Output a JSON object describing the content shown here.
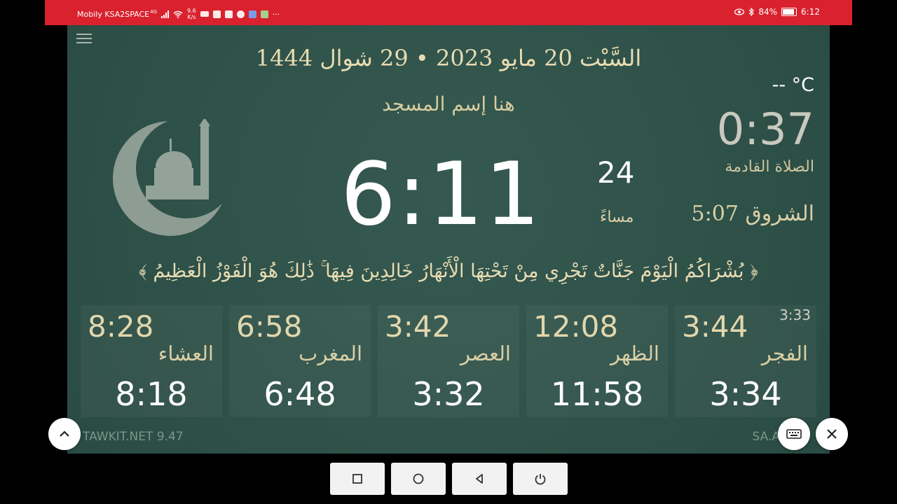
{
  "status_bar": {
    "carrier": "Mobily KSA2SPACE",
    "network": "4G",
    "net_speed_value": "9.6",
    "net_speed_unit": "K/s",
    "overflow": "···",
    "battery": "84%",
    "time": "6:12"
  },
  "app": {
    "date_line": "السَّبْت  20 مايو 2023  •  29 شوال 1444",
    "temperature": "-- °C",
    "mosque_name": "هنا إسم المسجد",
    "countdown": "0:37",
    "next_prayer_label": "الصلاة القادمة",
    "sunrise": "الشروق 5:07",
    "clock_time": "6:11",
    "clock_seconds": "24",
    "ampm": "مساءً",
    "verse": "﴿ بُشْرَاكُمُ الْيَوْمَ جَنَّاتٌ تَجْرِي مِنْ تَحْتِهَا الْأَنْهَارُ خَالِدِينَ فِيهَا ۚ ذَٰلِكَ هُوَ الْفَوْزُ الْعَظِيمُ ﴾",
    "prayers": [
      {
        "name": "العشاء",
        "adhan": "8:28",
        "iqama": "8:18",
        "extra": ""
      },
      {
        "name": "المغرب",
        "adhan": "6:58",
        "iqama": "6:48",
        "extra": ""
      },
      {
        "name": "العصر",
        "adhan": "3:42",
        "iqama": "3:32",
        "extra": ""
      },
      {
        "name": "الظهر",
        "adhan": "12:08",
        "iqama": "11:58",
        "extra": ""
      },
      {
        "name": "الفجر",
        "adhan": "3:44",
        "iqama": "3:34",
        "extra": "3:33"
      }
    ],
    "footer_left": "TAWKIT.NET 9.47",
    "footer_right": "SA.ALSH"
  },
  "icons": {
    "menu": "hamburger-icon",
    "scroll_up": "chevron-up-icon",
    "keyboard": "keyboard-icon",
    "close": "close-icon",
    "nav_recent": "square-icon",
    "nav_home": "circle-icon",
    "nav_back": "triangle-back-icon",
    "nav_power": "power-icon"
  },
  "colors": {
    "status_bar": "#d9222e",
    "app_background": "#2d5249",
    "gold_text": "#e8dcb2"
  }
}
